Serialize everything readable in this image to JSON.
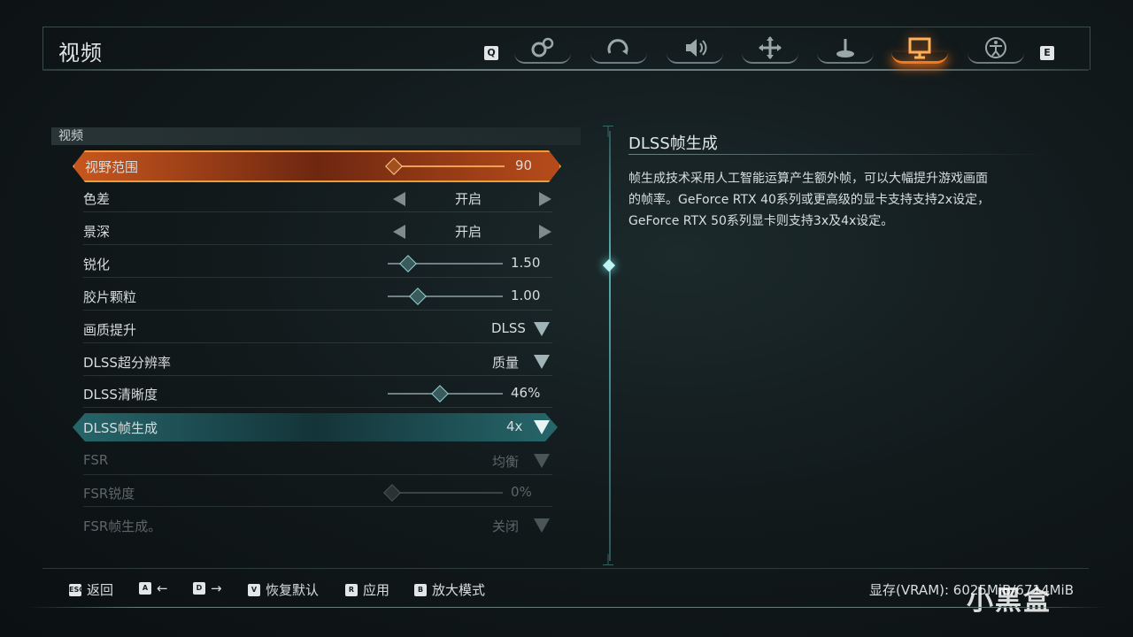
{
  "header": {
    "title": "视频",
    "key_left": "Q",
    "key_right": "E",
    "tabs": [
      {
        "icon": "gears-icon",
        "active": false
      },
      {
        "icon": "controller-spin-icon",
        "active": false
      },
      {
        "icon": "speaker-icon",
        "active": false
      },
      {
        "icon": "move-cross-icon",
        "active": false
      },
      {
        "icon": "joystick-icon",
        "active": false
      },
      {
        "icon": "monitor-icon",
        "active": true
      },
      {
        "icon": "accessibility-icon",
        "active": false
      }
    ]
  },
  "section": {
    "label": "视频"
  },
  "settings": [
    {
      "label": "视野范围",
      "type": "slider",
      "value": "90",
      "fraction": 0.03,
      "state": "selected-orange"
    },
    {
      "label": "色差",
      "type": "toggle",
      "value": "开启"
    },
    {
      "label": "景深",
      "type": "toggle",
      "value": "开启"
    },
    {
      "label": "锐化",
      "type": "slider",
      "value": "1.50",
      "fraction": 0.17
    },
    {
      "label": "胶片颗粒",
      "type": "slider",
      "value": "1.00",
      "fraction": 0.25
    },
    {
      "label": "画质提升",
      "type": "dropdown",
      "value": "DLSS"
    },
    {
      "label": "DLSS超分辨率",
      "type": "dropdown",
      "value": "质量"
    },
    {
      "label": "DLSS清晰度",
      "type": "slider",
      "value": "46%",
      "fraction": 0.46
    },
    {
      "label": "DLSS帧生成",
      "type": "dropdown",
      "value": "4x",
      "state": "selected-teal"
    },
    {
      "label": "FSR",
      "type": "dropdown",
      "value": "均衡",
      "state": "disabled"
    },
    {
      "label": "FSR锐度",
      "type": "slider",
      "value": "0%",
      "fraction": 0.0,
      "state": "disabled"
    },
    {
      "label": "FSR帧生成。",
      "type": "dropdown",
      "value": "关闭",
      "state": "disabled"
    }
  ],
  "description": {
    "title": "DLSS帧生成",
    "text": "帧生成技术采用人工智能运算产生额外帧，可以大幅提升游戏画面的帧率。GeForce RTX 40系列或更高级的显卡支持支持2x设定，GeForce RTX 50系列显卡则支持3x及4x设定。"
  },
  "footer": {
    "hints": [
      {
        "key": "ESC",
        "label": "返回"
      },
      {
        "key": "A",
        "label": "←"
      },
      {
        "key": "D",
        "label": "→"
      },
      {
        "key": "V",
        "label": "恢复默认"
      },
      {
        "key": "R",
        "label": "应用"
      },
      {
        "key": "B",
        "label": "放大模式"
      }
    ],
    "vram": "显存(VRAM): 6025MiB/6714MiB",
    "watermark": "小黑盒"
  },
  "colors": {
    "accent_orange": "#f07a20",
    "accent_teal": "#5aaeb0"
  }
}
